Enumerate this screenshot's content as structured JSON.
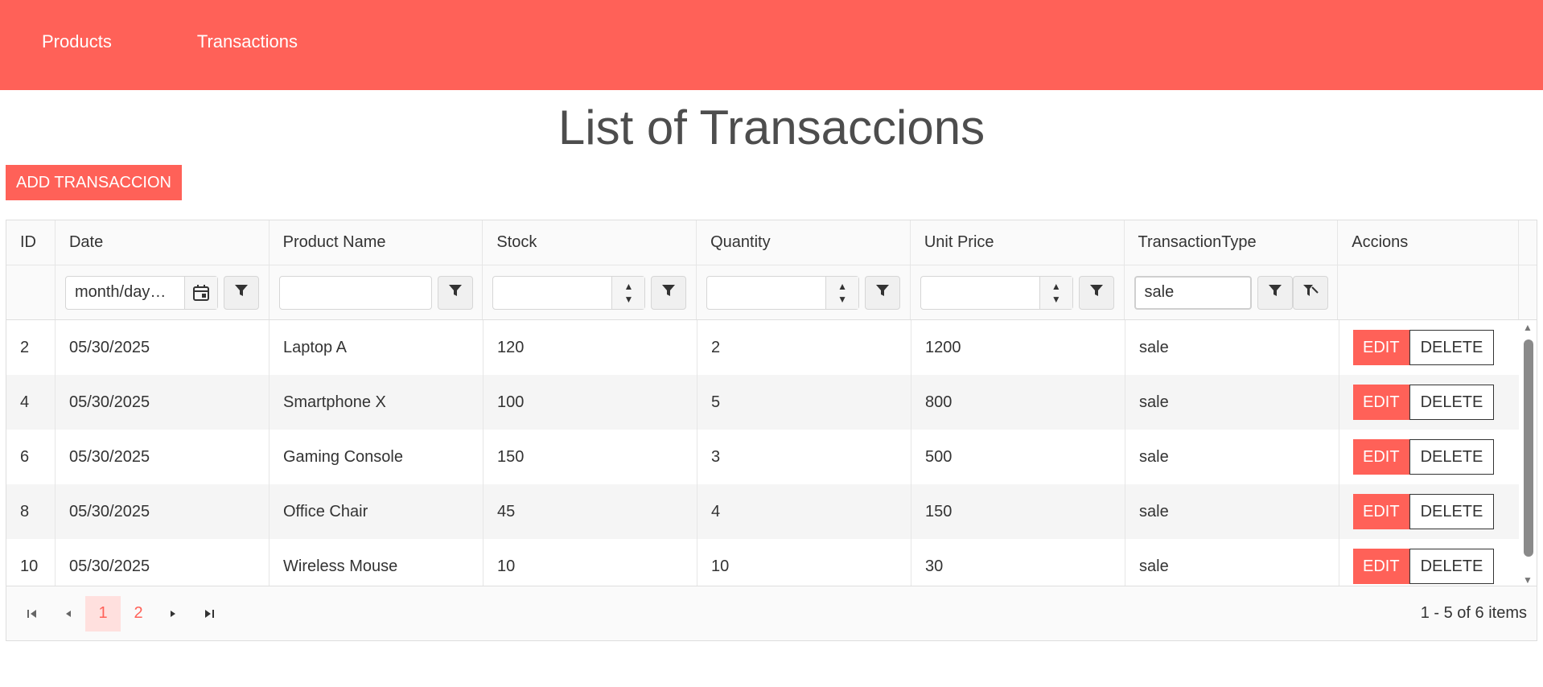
{
  "nav": {
    "products": "Products",
    "transactions": "Transactions"
  },
  "page": {
    "title": "List of Transaccions",
    "add_button": "ADD TRANSACCION"
  },
  "columns": [
    "ID",
    "Date",
    "Product Name",
    "Stock",
    "Quantity",
    "Unit Price",
    "TransactionType",
    "Accions"
  ],
  "filters": {
    "date_placeholder": "month/day…",
    "type_value": "sale"
  },
  "rows": [
    {
      "id": "2",
      "date": "05/30/2025",
      "name": "Laptop A",
      "stock": "120",
      "qty": "2",
      "price": "1200",
      "type": "sale"
    },
    {
      "id": "4",
      "date": "05/30/2025",
      "name": "Smartphone X",
      "stock": "100",
      "qty": "5",
      "price": "800",
      "type": "sale"
    },
    {
      "id": "6",
      "date": "05/30/2025",
      "name": "Gaming Console",
      "stock": "150",
      "qty": "3",
      "price": "500",
      "type": "sale"
    },
    {
      "id": "8",
      "date": "05/30/2025",
      "name": "Office Chair",
      "stock": "45",
      "qty": "4",
      "price": "150",
      "type": "sale"
    },
    {
      "id": "10",
      "date": "05/30/2025",
      "name": "Wireless Mouse",
      "stock": "10",
      "qty": "10",
      "price": "30",
      "type": "sale"
    }
  ],
  "actions": {
    "edit": "EDIT",
    "delete": "DELETE"
  },
  "pager": {
    "pages": [
      "1",
      "2"
    ],
    "info": "1 - 5 of 6 items"
  },
  "colors": {
    "accent": "#ff6158"
  }
}
